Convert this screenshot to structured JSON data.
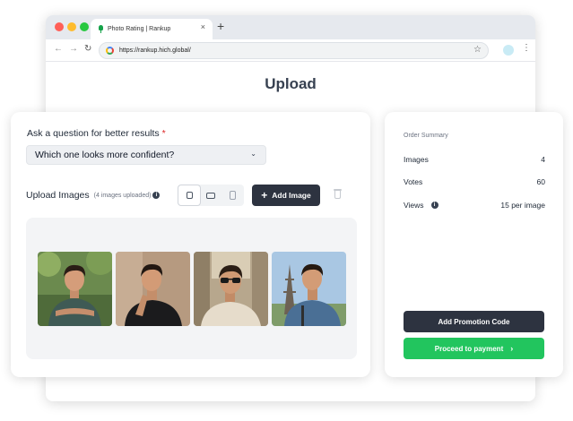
{
  "browser": {
    "tab_title": "Photo Rating | Rankup",
    "tab_close": "×",
    "new_tab": "+",
    "url": "https://rankup.hich.global/",
    "icons": {
      "back": "arrow-left-icon",
      "forward": "arrow-right-icon",
      "reload": "reload-icon",
      "site": "google-g-icon",
      "bookmark": "star-icon",
      "menu": "kebab-menu-icon"
    }
  },
  "page": {
    "title": "Upload"
  },
  "question": {
    "label": "Ask a question for better results",
    "required_mark": "*",
    "selected": "Which one looks more confident?"
  },
  "upload": {
    "label": "Upload Images",
    "count_text": "(4 images uploaded)",
    "info": "i",
    "add_button": "Add Image",
    "aspect_ratios": [
      "square",
      "landscape",
      "portrait"
    ],
    "active_ratio": "square",
    "photos": [
      "man-green-shirt-arms-crossed-park",
      "man-black-tshirt-hand-on-chin",
      "man-sunglasses-street",
      "man-denim-shirt-eiffel-tower"
    ]
  },
  "summary": {
    "title": "Order Summary",
    "rows": [
      {
        "label": "Images",
        "value": "4"
      },
      {
        "label": "Votes",
        "value": "60"
      },
      {
        "label": "Views",
        "value": "15 per image"
      }
    ],
    "promo_button": "Add Promotion Code",
    "pay_button": "Proceed to payment"
  },
  "colors": {
    "primary_dark": "#2d3340",
    "success": "#22c55e",
    "required": "#dc2626"
  }
}
